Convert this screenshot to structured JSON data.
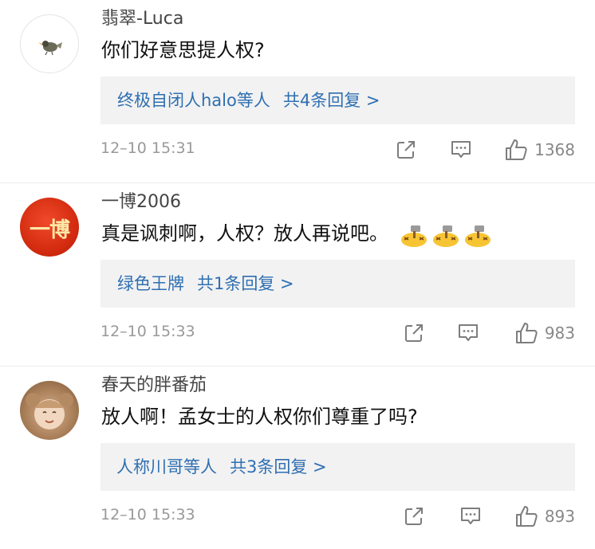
{
  "comments": [
    {
      "username": "翡翠-Luca",
      "text": "你们好意思提人权?",
      "emojis": [],
      "reply_users": "终极自闭人halo等人",
      "reply_count": "共4条回复 >",
      "time": "12–10 15:31",
      "likes": "1368"
    },
    {
      "username": "一博2006",
      "avatar_text": "一博",
      "text": "真是讽刺啊，人权？放人再说吧。",
      "emojis": [
        "hammer-face-emoji",
        "hammer-face-emoji",
        "hammer-face-emoji"
      ],
      "reply_users": "绿色王牌",
      "reply_count": "共1条回复 >",
      "time": "12–10 15:33",
      "likes": "983"
    },
    {
      "username": "春天的胖番茄",
      "text": "放人啊！孟女士的人权你们尊重了吗?",
      "emojis": [],
      "reply_users": "人称川哥等人",
      "reply_count": "共3条回复 >",
      "time": "12–10 15:33",
      "likes": "893"
    }
  ],
  "colors": {
    "link": "#2f6fb2",
    "meta": "#999999",
    "reply_bg": "#f2f2f2",
    "icon": "#7d7d7d"
  }
}
